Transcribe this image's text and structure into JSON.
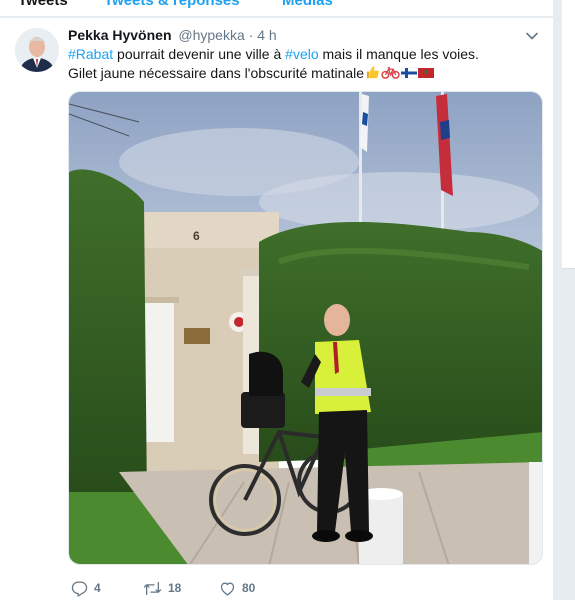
{
  "tabs": [
    "Tweets",
    "Tweets & réponses",
    "Médias"
  ],
  "tweet": {
    "author_name": "Pekka Hyvönen",
    "handle": "@hypekka",
    "separator": "·",
    "time": "4 h",
    "text": {
      "hashtag_1": "#Rabat",
      "part_1": " pourrait devenir une ville à ",
      "hashtag_2": "#velo",
      "part_2": " mais il manque les voies.",
      "line_2": "Gilet jaune nécessaire dans l'obscurité matinale"
    },
    "image": {
      "house_number": "6"
    },
    "actions": {
      "replies": "4",
      "retweets": "18",
      "likes": "80"
    }
  },
  "colors": {
    "accent": "#1da1f2",
    "text": "#14171a",
    "muted": "#657786",
    "background": "#e6ecf0"
  },
  "icons": [
    "chevron-down-icon",
    "reply-icon",
    "retweet-icon",
    "like-icon",
    "thumbs-up-emoji",
    "bicycle-emoji",
    "finland-flag-emoji",
    "morocco-flag-emoji"
  ]
}
